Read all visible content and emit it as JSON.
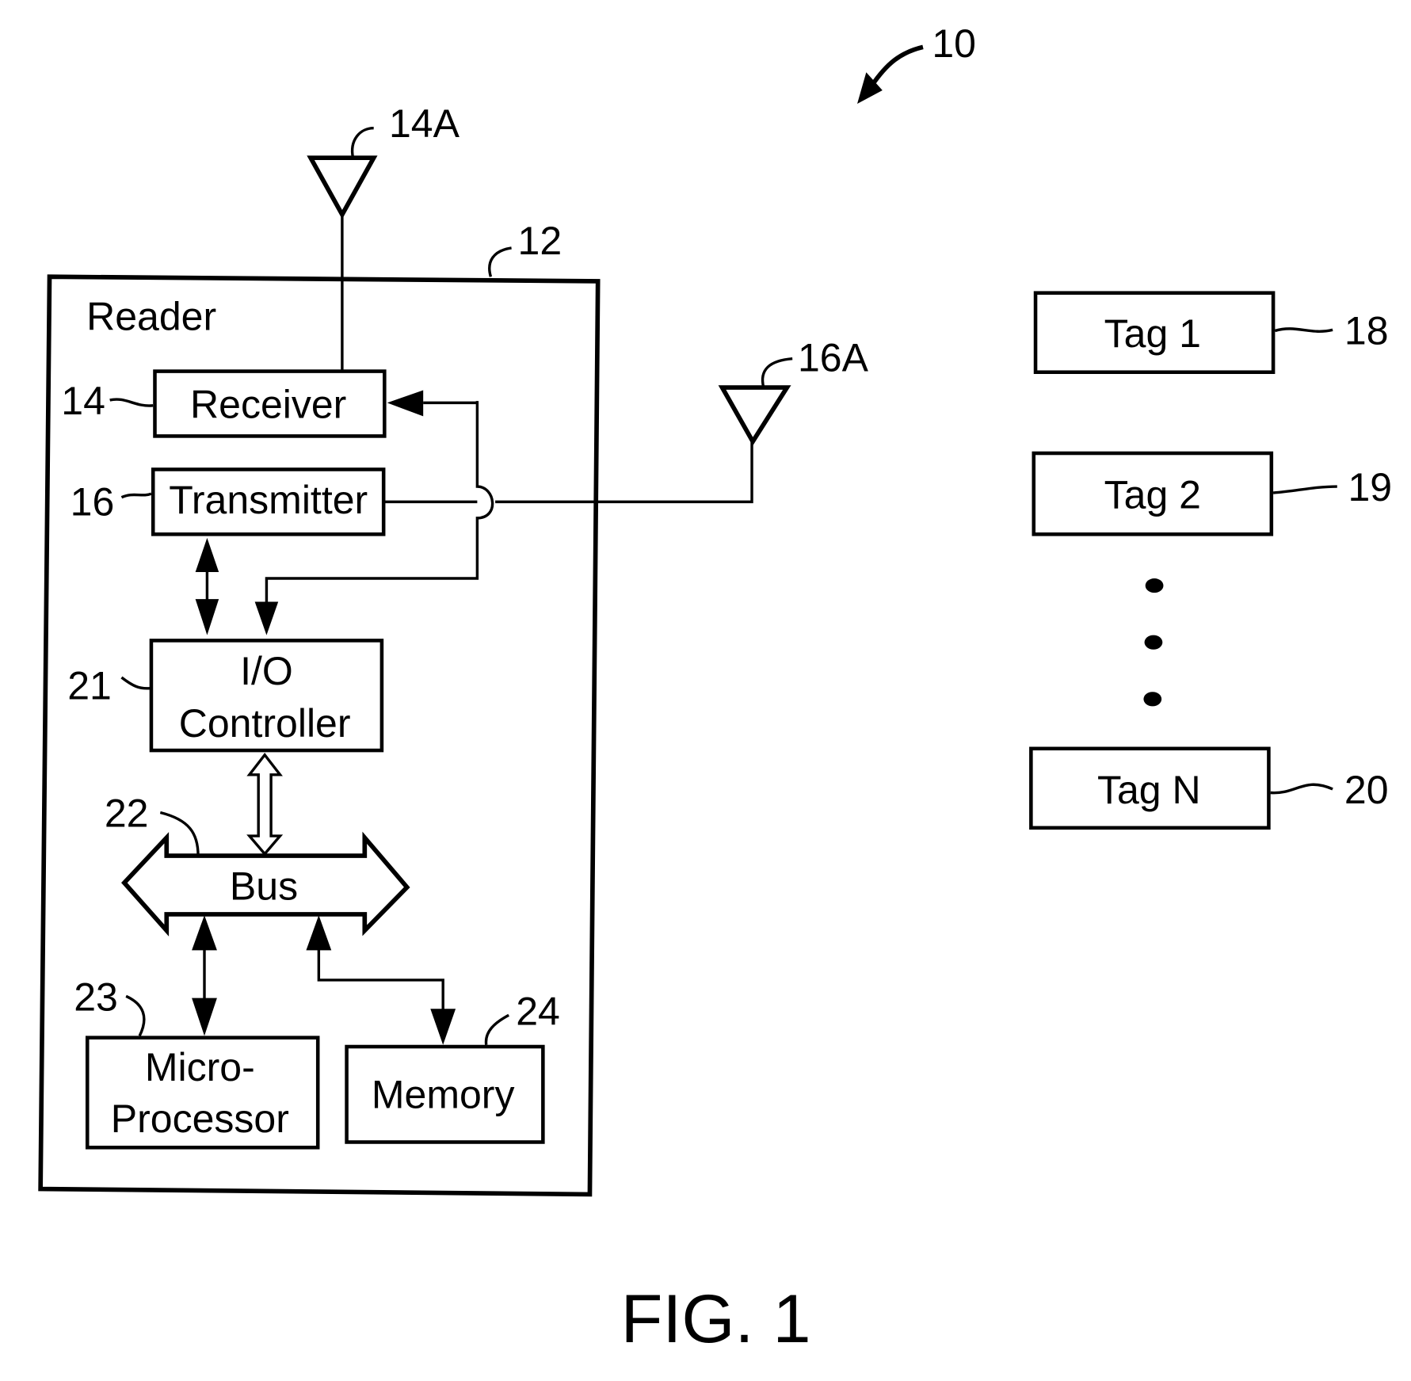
{
  "figure": {
    "caption": "FIG. 1",
    "system_ref": "10"
  },
  "reader": {
    "title": "Reader",
    "ref": "12",
    "components": {
      "receiver": {
        "label": "Receiver",
        "ref": "14"
      },
      "transmitter": {
        "label": "Transmitter",
        "ref": "16"
      },
      "io_controller": {
        "label_line1": "I/O",
        "label_line2": "Controller",
        "ref": "21"
      },
      "bus": {
        "label": "Bus",
        "ref": "22"
      },
      "microprocessor": {
        "label_line1": "Micro-",
        "label_line2": "Processor",
        "ref": "23"
      },
      "memory": {
        "label": "Memory",
        "ref": "24"
      }
    }
  },
  "antennas": {
    "receive": {
      "ref": "14A"
    },
    "transmit": {
      "ref": "16A"
    }
  },
  "tags": [
    {
      "label": "Tag 1",
      "ref": "18"
    },
    {
      "label": "Tag 2",
      "ref": "19"
    },
    {
      "label": "Tag N",
      "ref": "20"
    }
  ]
}
